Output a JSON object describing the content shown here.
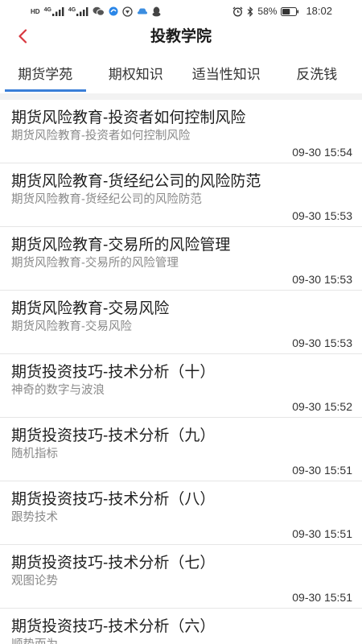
{
  "status_bar": {
    "hd_label": "HD",
    "network_1": "4G",
    "network_2": "4G",
    "battery_percent": "58%",
    "time": "18:02",
    "icons": [
      "wechat-icon",
      "browser-icon",
      "shield-icon",
      "car-icon",
      "qq-icon",
      "alarm-icon",
      "bluetooth-icon",
      "battery-icon"
    ]
  },
  "header": {
    "title": "投教学院",
    "back_icon": "chevron-left-icon"
  },
  "tabs": [
    {
      "label": "期货学苑",
      "selected": true
    },
    {
      "label": "期权知识",
      "selected": false
    },
    {
      "label": "适当性知识",
      "selected": false
    },
    {
      "label": "反洗钱",
      "selected": false
    }
  ],
  "articles": [
    {
      "title": "期货风险教育-投资者如何控制风险",
      "summary": "期货风险教育-投资者如何控制风险",
      "time": "09-30 15:54"
    },
    {
      "title": "期货风险教育-货经纪公司的风险防范",
      "summary": "期货风险教育-货经纪公司的风险防范",
      "time": "09-30 15:53"
    },
    {
      "title": "期货风险教育-交易所的风险管理",
      "summary": "期货风险教育-交易所的风险管理",
      "time": "09-30 15:53"
    },
    {
      "title": "期货风险教育-交易风险",
      "summary": "期货风险教育-交易风险",
      "time": "09-30 15:53"
    },
    {
      "title": "期货投资技巧-技术分析（十）",
      "summary": "神奇的数字与波浪",
      "time": "09-30 15:52"
    },
    {
      "title": "期货投资技巧-技术分析（九）",
      "summary": "随机指标",
      "time": "09-30 15:51"
    },
    {
      "title": "期货投资技巧-技术分析（八）",
      "summary": "跟势技术",
      "time": "09-30 15:51"
    },
    {
      "title": "期货投资技巧-技术分析（七）",
      "summary": "观图论势",
      "time": "09-30 15:51"
    },
    {
      "title": "期货投资技巧-技术分析（六）",
      "summary": "顺势而为"
    }
  ],
  "colors": {
    "accent": "#d8373f",
    "tab_indicator": "#3a7fd8",
    "title_text": "#1f1f1f",
    "summary_text": "#8a8a8a",
    "divider": "#e6e6e6",
    "section_gap": "#f2f2f2"
  }
}
